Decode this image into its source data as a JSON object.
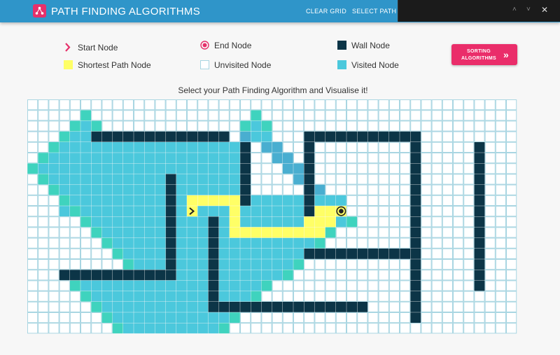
{
  "app": {
    "title": "PATH FINDING ALGORITHMS"
  },
  "nav": {
    "clear_grid": "CLEAR GRID",
    "select_path": "SELECT PATH FI"
  },
  "findbar": {
    "prev": "˄",
    "next": "˅",
    "close": "✕"
  },
  "legend": {
    "start": "Start Node",
    "end": "End Node",
    "wall": "Wall Node",
    "shortest": "Shortest Path Node",
    "unvisited": "Unvisited Node",
    "visited": "Visited Node"
  },
  "sort_button": {
    "label": "SORTING ALGORITHMS",
    "icon": "double-chevron-right-icon"
  },
  "heading": "Select your Path Finding Algorithm and Visualise it!",
  "colors": {
    "topbar": "#2f95c9",
    "accent": "#e6316b",
    "wall": "#0c3547",
    "visited": "#4bc8dc",
    "visited_edge": "#3fd3be",
    "visited_recent": "#49aed0",
    "path": "#ffff66",
    "unvisited_border": "#a9d6e2"
  },
  "grid": {
    "columns": 46,
    "rows": 22,
    "start": [
      10,
      15
    ],
    "end": [
      10,
      29
    ],
    "visited_spans": [
      [
        1,
        [
          [
            5,
            5
          ]
        ]
      ],
      [
        2,
        [
          [
            4,
            6
          ],
          [
            21,
            21
          ]
        ]
      ],
      [
        3,
        [
          [
            3,
            6
          ],
          [
            20,
            22
          ]
        ]
      ],
      [
        4,
        [
          [
            2,
            20
          ],
          [
            22,
            23
          ]
        ]
      ],
      [
        5,
        [
          [
            1,
            20
          ],
          [
            23,
            24
          ]
        ]
      ],
      [
        6,
        [
          [
            0,
            20
          ],
          [
            24,
            26
          ]
        ]
      ],
      [
        7,
        [
          [
            1,
            20
          ],
          [
            25,
            26
          ]
        ]
      ],
      [
        8,
        [
          [
            2,
            20
          ],
          [
            26,
            27
          ]
        ]
      ],
      [
        9,
        [
          [
            3,
            29
          ]
        ]
      ],
      [
        10,
        [
          [
            3,
            29
          ]
        ]
      ],
      [
        11,
        [
          [
            5,
            30
          ]
        ]
      ],
      [
        12,
        [
          [
            6,
            28
          ]
        ]
      ],
      [
        13,
        [
          [
            7,
            27
          ]
        ]
      ],
      [
        14,
        [
          [
            8,
            26
          ]
        ]
      ],
      [
        15,
        [
          [
            9,
            25
          ]
        ]
      ],
      [
        16,
        [
          [
            3,
            24
          ]
        ]
      ],
      [
        17,
        [
          [
            4,
            22
          ]
        ]
      ],
      [
        18,
        [
          [
            5,
            21
          ]
        ]
      ],
      [
        19,
        [
          [
            6,
            20
          ]
        ]
      ],
      [
        20,
        [
          [
            7,
            19
          ]
        ]
      ],
      [
        21,
        [
          [
            8,
            18
          ]
        ]
      ]
    ],
    "edge_cells": [
      [
        1,
        5
      ],
      [
        2,
        4
      ],
      [
        2,
        6
      ],
      [
        3,
        3
      ],
      [
        4,
        2
      ],
      [
        5,
        1
      ],
      [
        6,
        0
      ],
      [
        7,
        1
      ],
      [
        8,
        2
      ],
      [
        9,
        3
      ],
      [
        10,
        4
      ],
      [
        11,
        5
      ],
      [
        12,
        6
      ],
      [
        13,
        7
      ],
      [
        14,
        8
      ],
      [
        15,
        9
      ],
      [
        16,
        3
      ],
      [
        17,
        4
      ],
      [
        18,
        5
      ],
      [
        19,
        6
      ],
      [
        20,
        7
      ],
      [
        21,
        8
      ],
      [
        1,
        21
      ],
      [
        2,
        20
      ],
      [
        2,
        22
      ],
      [
        19,
        20
      ],
      [
        20,
        19
      ],
      [
        21,
        18
      ],
      [
        17,
        22
      ],
      [
        18,
        21
      ],
      [
        16,
        24
      ],
      [
        15,
        25
      ],
      [
        13,
        27
      ],
      [
        12,
        28
      ],
      [
        11,
        30
      ],
      [
        10,
        29
      ]
    ],
    "recent_cells": [
      [
        3,
        20
      ],
      [
        4,
        22
      ],
      [
        4,
        23
      ],
      [
        5,
        23
      ],
      [
        5,
        24
      ],
      [
        6,
        24
      ],
      [
        6,
        25
      ],
      [
        6,
        26
      ],
      [
        7,
        25
      ],
      [
        7,
        26
      ],
      [
        8,
        26
      ],
      [
        8,
        27
      ]
    ],
    "walls": [
      [
        3,
        [
          [
            6,
            18
          ],
          [
            26,
            36
          ]
        ]
      ],
      [
        4,
        [
          [
            20,
            20
          ],
          [
            26,
            26
          ]
        ]
      ],
      [
        5,
        [
          [
            20,
            20
          ],
          [
            26,
            26
          ]
        ]
      ],
      [
        6,
        [
          [
            20,
            20
          ],
          [
            26,
            26
          ]
        ]
      ],
      [
        7,
        [
          [
            13,
            13
          ],
          [
            20,
            20
          ],
          [
            26,
            26
          ]
        ]
      ],
      [
        8,
        [
          [
            13,
            13
          ],
          [
            20,
            20
          ],
          [
            26,
            26
          ]
        ]
      ],
      [
        9,
        [
          [
            13,
            13
          ],
          [
            20,
            20
          ],
          [
            26,
            26
          ]
        ]
      ],
      [
        10,
        [
          [
            13,
            13
          ],
          [
            26,
            26
          ]
        ]
      ],
      [
        11,
        [
          [
            13,
            13
          ],
          [
            17,
            17
          ]
        ]
      ],
      [
        12,
        [
          [
            13,
            13
          ],
          [
            17,
            17
          ]
        ]
      ],
      [
        13,
        [
          [
            13,
            13
          ],
          [
            17,
            17
          ]
        ]
      ],
      [
        14,
        [
          [
            13,
            13
          ],
          [
            17,
            17
          ],
          [
            26,
            35
          ]
        ]
      ],
      [
        15,
        [
          [
            13,
            13
          ],
          [
            17,
            17
          ]
        ]
      ],
      [
        16,
        [
          [
            3,
            13
          ],
          [
            17,
            17
          ]
        ]
      ],
      [
        17,
        [
          [
            17,
            17
          ]
        ]
      ],
      [
        18,
        [
          [
            17,
            17
          ]
        ]
      ],
      [
        19,
        [
          [
            17,
            31
          ]
        ]
      ]
    ],
    "wall_columns": [
      [
        36,
        4,
        20
      ],
      [
        42,
        4,
        17
      ]
    ],
    "path_spans": [
      [
        9,
        [
          [
            15,
            19
          ]
        ]
      ],
      [
        10,
        [
          [
            15,
            15
          ],
          [
            19,
            19
          ],
          [
            27,
            29
          ]
        ]
      ],
      [
        11,
        [
          [
            19,
            19
          ],
          [
            26,
            28
          ]
        ]
      ],
      [
        12,
        [
          [
            19,
            27
          ]
        ]
      ]
    ]
  }
}
